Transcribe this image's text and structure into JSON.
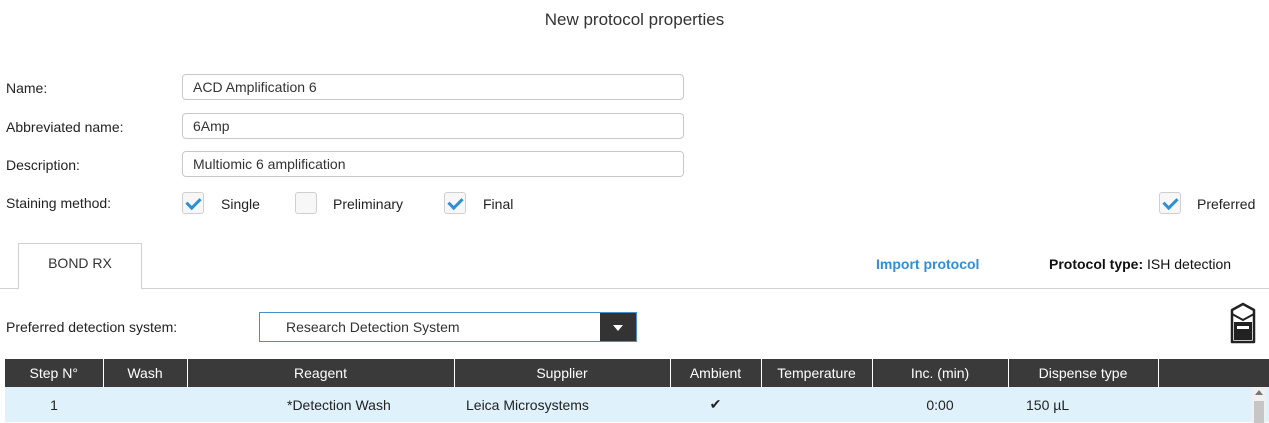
{
  "title": "New protocol properties",
  "form": {
    "name_label": "Name:",
    "name_value": "ACD Amplification 6",
    "abbrev_label": "Abbreviated name:",
    "abbrev_value": "6Amp",
    "description_label": "Description:",
    "description_value": "Multiomic 6 amplification",
    "staining_label": "Staining method:",
    "staining_options": [
      {
        "label": "Single",
        "checked": true
      },
      {
        "label": "Preliminary",
        "checked": false
      },
      {
        "label": "Final",
        "checked": true
      }
    ],
    "preferred_label": "Preferred",
    "preferred_checked": true
  },
  "tabs": [
    {
      "label": "BOND RX"
    }
  ],
  "import_label": "Import protocol",
  "protocol_type_label": "Protocol type:",
  "protocol_type_value": "ISH detection",
  "detection": {
    "label": "Preferred detection system:",
    "selected": "Research Detection System"
  },
  "table": {
    "columns": [
      "Step N°",
      "Wash",
      "Reagent",
      "Supplier",
      "Ambient",
      "Temperature",
      "Inc. (min)",
      "Dispense type"
    ],
    "rows": [
      {
        "step": "1",
        "wash": "",
        "reagent": "*Detection Wash",
        "supplier": "Leica Microsystems",
        "ambient": "✔",
        "temperature": "",
        "inc": "0:00",
        "dispense": "150 µL"
      }
    ]
  },
  "colors": {
    "accent": "#2e8fd6",
    "header_bg": "#3a3a3a",
    "row_selected": "#dff1fb"
  },
  "icons": [
    "checkbox-checked-icon",
    "dropdown-arrow-icon",
    "instrument-icon",
    "scroll-up-icon"
  ]
}
